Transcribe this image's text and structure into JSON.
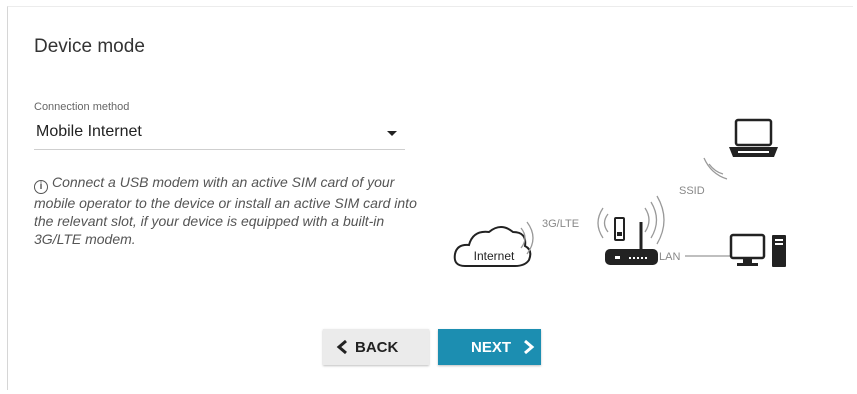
{
  "page": {
    "title": "Device mode"
  },
  "connection": {
    "label": "Connection method",
    "value": "Mobile Internet"
  },
  "info": {
    "icon": "info-icon",
    "text": "Connect a USB modem with an active SIM card of your mobile operator to the device or install an active SIM card into the relevant slot, if your device is equipped with a built-in 3G/LTE modem."
  },
  "diagram": {
    "internet_label": "Internet",
    "mobile_label": "3G/LTE",
    "ssid_label": "SSID",
    "lan_label": "LAN"
  },
  "buttons": {
    "back": "BACK",
    "next": "NEXT"
  },
  "colors": {
    "accent": "#1c8eb1",
    "back_bg": "#ebebeb"
  }
}
